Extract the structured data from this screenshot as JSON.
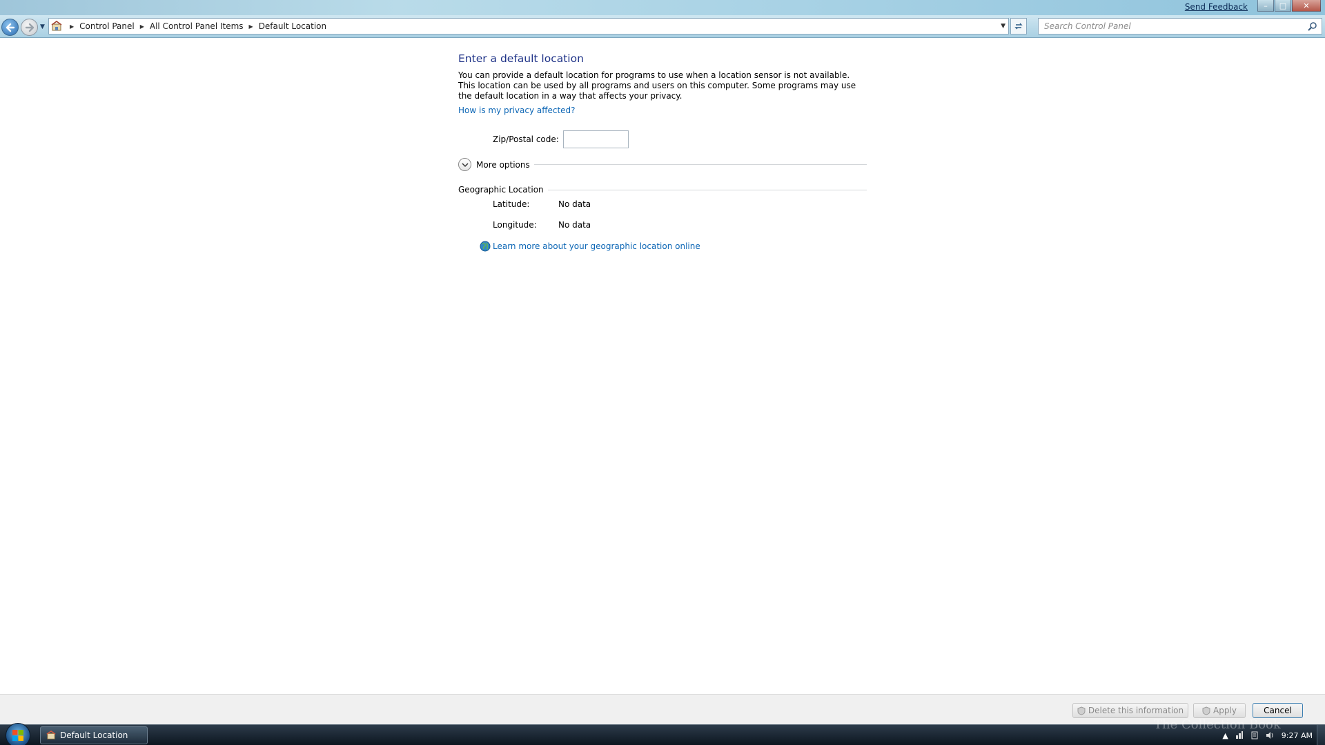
{
  "window": {
    "send_feedback": "Send Feedback",
    "minimize": "–",
    "maximize": "□",
    "close": "✕"
  },
  "nav": {
    "breadcrumbs": [
      "Control Panel",
      "All Control Panel Items",
      "Default Location"
    ],
    "search_placeholder": "Search Control Panel",
    "icons": [
      "back-arrow-icon",
      "forward-arrow-icon",
      "control-panel-icon",
      "refresh-icon",
      "search-icon"
    ]
  },
  "main": {
    "title": "Enter a default location",
    "description": "You can provide a default location for programs to use when a location sensor is not available. This location can be used by all programs and users on this computer. Some programs may use the default location in a way that affects your privacy.",
    "privacy_link": "How is my privacy affected?",
    "zip_label": "Zip/Postal code:",
    "zip_value": "",
    "more_options": "More options",
    "geo_heading": "Geographic Location",
    "latitude_label": "Latitude:",
    "latitude_value": "No data",
    "longitude_label": "Longitude:",
    "longitude_value": "No data",
    "learn_more": "Learn more about your geographic location online"
  },
  "buttons": {
    "delete": "Delete this information",
    "apply": "Apply",
    "cancel": "Cancel"
  },
  "taskbar": {
    "task_label": "Default Location",
    "clock": "9:27 AM",
    "watermark": "The Collection Book"
  },
  "colors": {
    "title": "#1e3287",
    "link": "#0c66b5",
    "taskbar": "#1a2633"
  }
}
